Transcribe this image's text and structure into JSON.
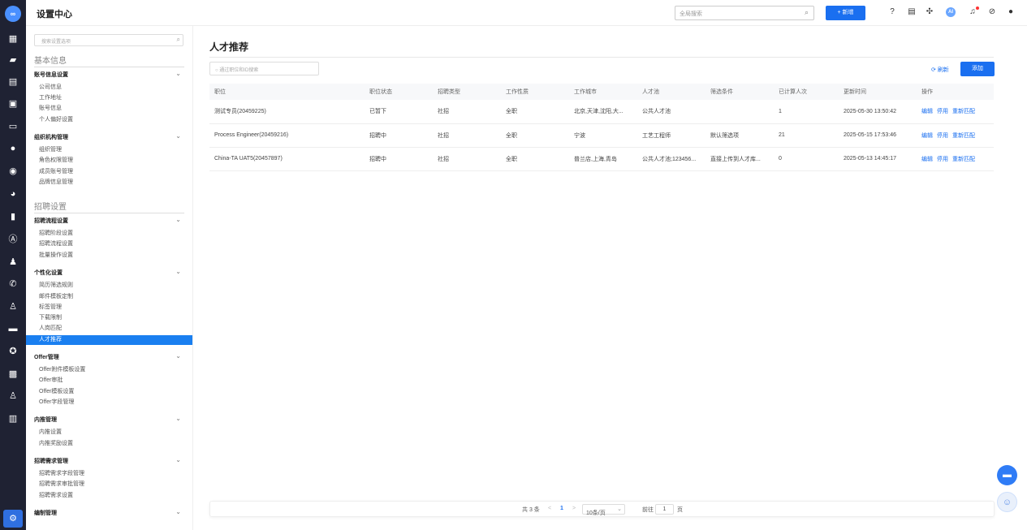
{
  "rail": {
    "logo_icon": "infinity-logo",
    "icons": [
      "grid-icon",
      "briefcase-icon",
      "document-icon",
      "board-icon",
      "card-icon",
      "chat-icon",
      "circle-icon",
      "pie-icon",
      "bar-chart-icon",
      "badge-icon",
      "users-icon",
      "phone-icon",
      "user-add-icon",
      "message-icon",
      "gear-circle-icon",
      "id-card-icon",
      "person-icon",
      "clipboard-icon",
      "settings-icon"
    ]
  },
  "header": {
    "title": "设置中心",
    "search_placeholder": "全局搜索",
    "new_label": "+ 新增",
    "ai_label": "AI"
  },
  "sidebar": {
    "search_placeholder": "搜索设置选项",
    "section1": "基本信息",
    "section2": "招聘设置",
    "groups": {
      "account": "账号信息设置",
      "org": "组织机构管理",
      "flow": "招聘流程设置",
      "custom": "个性化设置",
      "offer": "Offer管理",
      "referral": "内推管理",
      "demand": "招聘需求管理",
      "staffing": "编制管理"
    },
    "items": {
      "account": [
        "公司信息",
        "工作地址",
        "账号信息",
        "个人偏好设置"
      ],
      "org": [
        "组织管理",
        "角色权限管理",
        "成员账号管理",
        "品牌信息管理"
      ],
      "flow": [
        "招聘阶段设置",
        "招聘流程设置",
        "批量操作设置"
      ],
      "custom": [
        "简历筛选规则",
        "邮件模板定制",
        "标签管理",
        "下载限制",
        "人岗匹配",
        "人才推荐"
      ],
      "offer": [
        "Offer附件模板设置",
        "Offer审批",
        "Offer模板设置",
        "Offer字段管理"
      ],
      "referral": [
        "内推设置",
        "内推奖励设置"
      ],
      "demand": [
        "招聘需求字段管理",
        "招聘需求审批管理",
        "招聘需求设置"
      ]
    }
  },
  "main": {
    "title": "人才推荐",
    "search_placeholder": "通过职位和ID搜索",
    "refresh_label": "刷新",
    "add_label": "添加",
    "columns": [
      "职位",
      "职位状态",
      "招聘类型",
      "工作性质",
      "工作城市",
      "人才池",
      "筛选条件",
      "已计算人次",
      "更新时间",
      "操作"
    ],
    "rows": [
      [
        "测试专员(20459225)",
        "已暂下",
        "社招",
        "全职",
        "北京,天津,沈阳,大...",
        "公共人才池",
        "",
        "1",
        "2025-05-30 13:50:42"
      ],
      [
        "Process Engineer(20459216)",
        "招聘中",
        "社招",
        "全职",
        "宁波",
        "工艺工程师",
        "默认筛选项",
        "21",
        "2025-05-15 17:53:46"
      ],
      [
        "China-TA UAT5(20457897)",
        "招聘中",
        "社招",
        "全职",
        "普兰店,上海,青岛",
        "公共人才池;123456...",
        "直接上传到人才库...",
        "0",
        "2025-05-13 14:45:17"
      ]
    ],
    "actions": [
      "编辑",
      "停用",
      "重新匹配"
    ]
  },
  "pager": {
    "total": "共 3 条",
    "prev": "<",
    "page": "1",
    "next": ">",
    "size": "10条/页",
    "goto": "前往",
    "goto_value": "1",
    "page_suffix": "页"
  }
}
